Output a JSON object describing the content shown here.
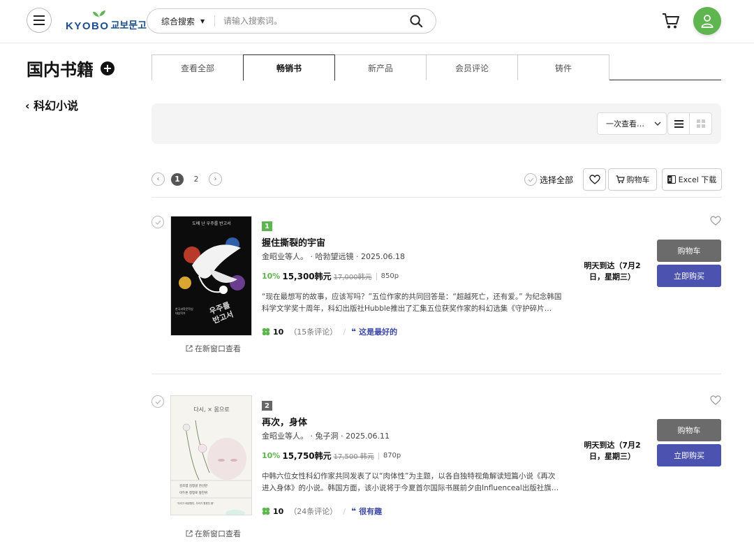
{
  "header": {
    "logo_en": "KYOBO",
    "logo_ko": "교보문고",
    "search_category": "综合搜索",
    "search_placeholder": "请输入搜索词。"
  },
  "sidebar": {
    "title": "国内书籍",
    "sub_category": "科幻小说"
  },
  "tabs": [
    {
      "label": "查看全部",
      "active": false
    },
    {
      "label": "畅销书",
      "active": true
    },
    {
      "label": "新产品",
      "active": false
    },
    {
      "label": "会员评论",
      "active": false
    },
    {
      "label": "铸件",
      "active": false
    }
  ],
  "filter": {
    "view_select": "一次查看…"
  },
  "pagination": {
    "pages": [
      "1",
      "2"
    ],
    "current": "1"
  },
  "actions": {
    "select_all": "选择全部",
    "cart": "购物车",
    "excel": "Excel 下载"
  },
  "books": [
    {
      "rank": "1",
      "rank_color": "#5fb650",
      "title": "握住撕裂的宇宙",
      "meta": "金昭业等人。 · 哈勃望远镜 · 2025.06.18",
      "discount": "10%",
      "price": "15,300韩元",
      "original_price": "17,000韩元",
      "points": "850p",
      "description": "“现在最想写的故事，应该写吗？”五位作家的共同回答是：“超越死亡，还有爱。” 为纪念韩国科学文学奖十周年，科幻出版社Hubble推出了汇集五位获奖作家的科幻选集《守护碎片…",
      "score": "10",
      "reviews": "（15条评论）",
      "tag": "这是最好的",
      "delivery": "明天到达（7月2日，星期三）",
      "cart_label": "购物车",
      "buy_label": "立即购买",
      "new_window": "在新窗口查看",
      "cover_text": "도배 난 우주를 반고서"
    },
    {
      "rank": "2",
      "rank_color": "#666666",
      "title": "再次，身体",
      "meta": "金昭业等人。 · 兔子洞 · 2025.06.11",
      "discount": "10%",
      "price": "15,750韩元",
      "original_price": "17,500 韩元",
      "points": "870p",
      "description": "中韩六位女性科幻作家共同发表了以“肉体性”为主题，以各自独特视角解读短篇小说《再次进入身体》的小说。韩国方面，该小说将于今夏首尔国际书展前夕由Influenceal出版社旗…",
      "score": "10",
      "reviews": "（24条评论）",
      "tag": "很有趣",
      "delivery": "明天到达（7月2日，星期三）",
      "cart_label": "购物车",
      "buy_label": "立即购买",
      "new_window": "在新窗口查看",
      "cover_text": "다시, × 몸으로"
    }
  ]
}
